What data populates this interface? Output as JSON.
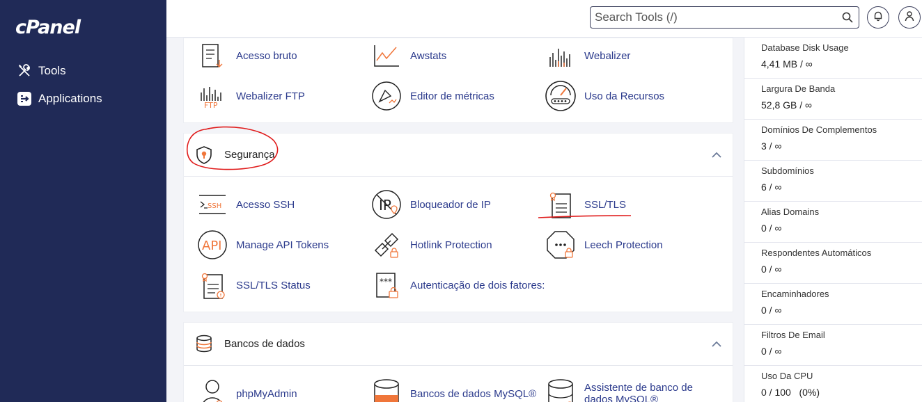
{
  "sidebar": {
    "logo": "cPanel",
    "items": [
      {
        "label": "Tools",
        "icon": "tools-icon"
      },
      {
        "label": "Applications",
        "icon": "applications-icon"
      }
    ]
  },
  "search": {
    "placeholder": "Search Tools (/)"
  },
  "sections": {
    "metrics_tools": [
      {
        "label": "Acesso bruto",
        "icon": "raw-access-icon"
      },
      {
        "label": "Awstats",
        "icon": "awstats-icon"
      },
      {
        "label": "Webalizer",
        "icon": "webalizer-icon"
      },
      {
        "label": "Webalizer FTP",
        "icon": "webalizer-ftp-icon"
      },
      {
        "label": "Editor de métricas",
        "icon": "metrics-editor-icon"
      },
      {
        "label": "Uso da Recursos",
        "icon": "resource-usage-icon"
      }
    ],
    "security": {
      "title": "Segurança",
      "tools": [
        {
          "label": "Acesso SSH",
          "icon": "ssh-icon"
        },
        {
          "label": "Bloqueador de IP",
          "icon": "ip-blocker-icon"
        },
        {
          "label": "SSL/TLS",
          "icon": "ssl-tls-icon"
        },
        {
          "label": "Manage API Tokens",
          "icon": "api-icon"
        },
        {
          "label": "Hotlink Protection",
          "icon": "hotlink-icon"
        },
        {
          "label": "Leech Protection",
          "icon": "leech-icon"
        },
        {
          "label": "SSL/TLS Status",
          "icon": "ssl-status-icon"
        },
        {
          "label": "Autenticação de dois fatores:",
          "icon": "two-factor-icon"
        }
      ]
    },
    "databases": {
      "title": "Bancos de dados",
      "tools": [
        {
          "label": "phpMyAdmin",
          "icon": "phpmyadmin-icon"
        },
        {
          "label": "Bancos de dados MySQL®",
          "icon": "mysql-icon"
        },
        {
          "label": "Assistente de banco de dados MySQL®",
          "icon": "mysql-wizard-icon"
        }
      ]
    }
  },
  "stats": [
    {
      "label": "Database Disk Usage",
      "value": "4,41 MB / ∞"
    },
    {
      "label": "Largura De Banda",
      "value": "52,8 GB / ∞"
    },
    {
      "label": "Domínios De Complementos",
      "value": "3 / ∞"
    },
    {
      "label": "Subdomínios",
      "value": "6 / ∞"
    },
    {
      "label": "Alias Domains",
      "value": "0 / ∞"
    },
    {
      "label": "Respondentes Automáticos",
      "value": "0 / ∞"
    },
    {
      "label": "Encaminhadores",
      "value": "0 / ∞"
    },
    {
      "label": "Filtros De Email",
      "value": "0 / ∞"
    },
    {
      "label": "Uso Da CPU",
      "value": "0 / 100   (0%)"
    }
  ],
  "colors": {
    "sidebar": "#202a57",
    "link": "#2b3a8c",
    "accent": "#f0763a",
    "annotation": "#e01b1b"
  }
}
